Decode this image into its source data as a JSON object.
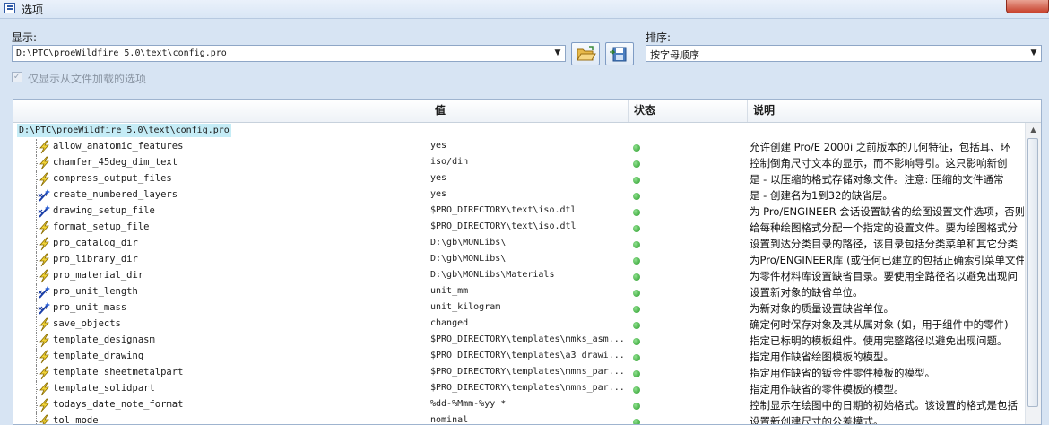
{
  "window": {
    "title": "选项"
  },
  "display": {
    "label": "显示:",
    "value": "D:\\PTC\\proeWildfire 5.0\\text\\config.pro",
    "open_button": "folder-open-icon",
    "save_button": "save-file-icon"
  },
  "sort": {
    "label": "排序:",
    "value": "按字母顺序"
  },
  "filter": {
    "label": "仅显示从文件加载的选项",
    "checked": true
  },
  "table": {
    "columns": [
      "值",
      "状态",
      "说明"
    ],
    "root": "D:\\PTC\\proeWildfire 5.0\\text\\config.pro",
    "status_color": "#2e9e2e",
    "rows": [
      {
        "name": "allow_anatomic_features",
        "value": "yes",
        "icon": "lightning-icon",
        "desc": "允许创建 Pro/E 2000i 之前版本的几何特征，包括耳、环"
      },
      {
        "name": "chamfer_45deg_dim_text",
        "value": "iso/din",
        "icon": "lightning-icon",
        "desc": "控制倒角尺寸文本的显示，而不影响导引。这只影响新创"
      },
      {
        "name": "compress_output_files",
        "value": "yes",
        "icon": "lightning-icon",
        "desc": "是 - 以压缩的格式存储对象文件。注意: 压缩的文件通常"
      },
      {
        "name": "create_numbered_layers",
        "value": "yes",
        "icon": "wand-icon",
        "desc": "是 - 创建名为1到32的缺省层。"
      },
      {
        "name": "drawing_setup_file",
        "value": "$PRO_DIRECTORY\\text\\iso.dtl",
        "icon": "wand-icon",
        "desc": "为 Pro/ENGINEER 会话设置缺省的绘图设置文件选项，否则"
      },
      {
        "name": "format_setup_file",
        "value": "$PRO_DIRECTORY\\text\\iso.dtl",
        "icon": "lightning-icon",
        "desc": "给每种绘图格式分配一个指定的设置文件。要为绘图格式分"
      },
      {
        "name": "pro_catalog_dir",
        "value": "D:\\gb\\MONLibs\\",
        "icon": "lightning-icon",
        "desc": "设置到达分类目录的路径，该目录包括分类菜单和其它分类"
      },
      {
        "name": "pro_library_dir",
        "value": "D:\\gb\\MONLibs\\",
        "icon": "lightning-icon",
        "desc": "为Pro/ENGINEER库 (或任何已建立的包括正确索引菜单文件"
      },
      {
        "name": "pro_material_dir",
        "value": "D:\\gb\\MONLibs\\Materials",
        "icon": "lightning-icon",
        "desc": "为零件材料库设置缺省目录。要使用全路径名以避免出现问"
      },
      {
        "name": "pro_unit_length",
        "value": "unit_mm",
        "icon": "wand-icon",
        "desc": "设置新对象的缺省单位。"
      },
      {
        "name": "pro_unit_mass",
        "value": "unit_kilogram",
        "icon": "wand-icon",
        "desc": "为新对象的质量设置缺省单位。"
      },
      {
        "name": "save_objects",
        "value": "changed",
        "icon": "lightning-icon",
        "desc": "确定何时保存对象及其从属对象 (如，用于组件中的零件)"
      },
      {
        "name": "template_designasm",
        "value": "$PRO_DIRECTORY\\templates\\mmks_asm...",
        "icon": "lightning-icon",
        "desc": "指定已标明的模板组件。使用完整路径以避免出现问题。"
      },
      {
        "name": "template_drawing",
        "value": "$PRO_DIRECTORY\\templates\\a3_drawi...",
        "icon": "lightning-icon",
        "desc": "指定用作缺省绘图模板的模型。"
      },
      {
        "name": "template_sheetmetalpart",
        "value": "$PRO_DIRECTORY\\templates\\mmns_par...",
        "icon": "lightning-icon",
        "desc": "指定用作缺省的钣金件零件模板的模型。"
      },
      {
        "name": "template_solidpart",
        "value": "$PRO_DIRECTORY\\templates\\mmns_par...",
        "icon": "lightning-icon",
        "desc": "指定用作缺省的零件模板的模型。"
      },
      {
        "name": "todays_date_note_format",
        "value": "%dd-%Mmm-%yy *",
        "icon": "lightning-icon",
        "desc": "控制显示在绘图中的日期的初始格式。该设置的格式是包括"
      },
      {
        "name": "tol_mode",
        "value": "nominal",
        "icon": "lightning-icon",
        "desc": "设置新创建尺寸的公差模式。"
      }
    ]
  }
}
